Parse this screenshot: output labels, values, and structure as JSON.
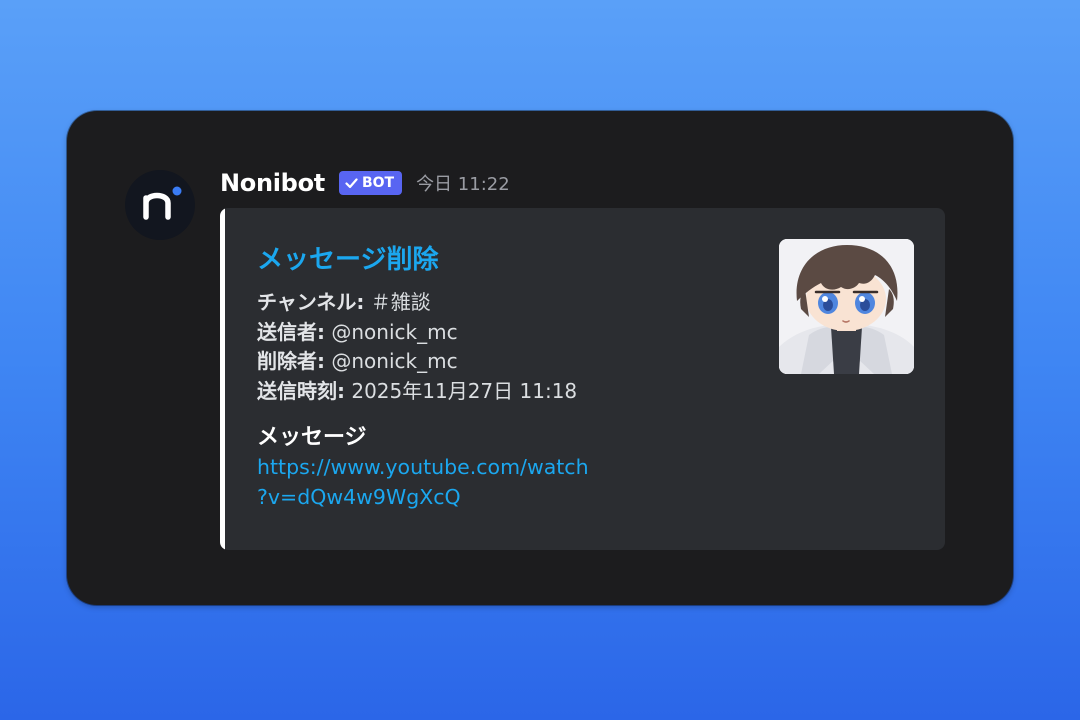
{
  "message": {
    "author": {
      "name": "Nonibot",
      "badge": "BOT",
      "avatar_icon": "nonibot-logo-icon"
    },
    "timestamp": "今日 11:22",
    "embed": {
      "accent_color": "#ffffff",
      "title": "メッセージ削除",
      "title_color": "#1ba7ef",
      "fields": [
        {
          "label": "チャンネル:",
          "value": "＃雑談"
        },
        {
          "label": "送信者:",
          "value": "@nonick_mc"
        },
        {
          "label": "削除者:",
          "value": "@nonick_mc"
        },
        {
          "label": "送信時刻:",
          "value": "2025年11月27日 11:18"
        }
      ],
      "content_heading": "メッセージ",
      "content_link": {
        "line1": "https://www.youtube.com/watch",
        "line2": "?v=dQw4w9WgXcQ"
      },
      "thumbnail_icon": "user-avatar-thumbnail"
    }
  },
  "colors": {
    "background_top": "#5aa0f8",
    "background_bottom": "#2b66e8",
    "card": "#1c1c1e",
    "embed": "#2b2d31",
    "bot_badge": "#5865f2",
    "link": "#1ba7ef"
  }
}
